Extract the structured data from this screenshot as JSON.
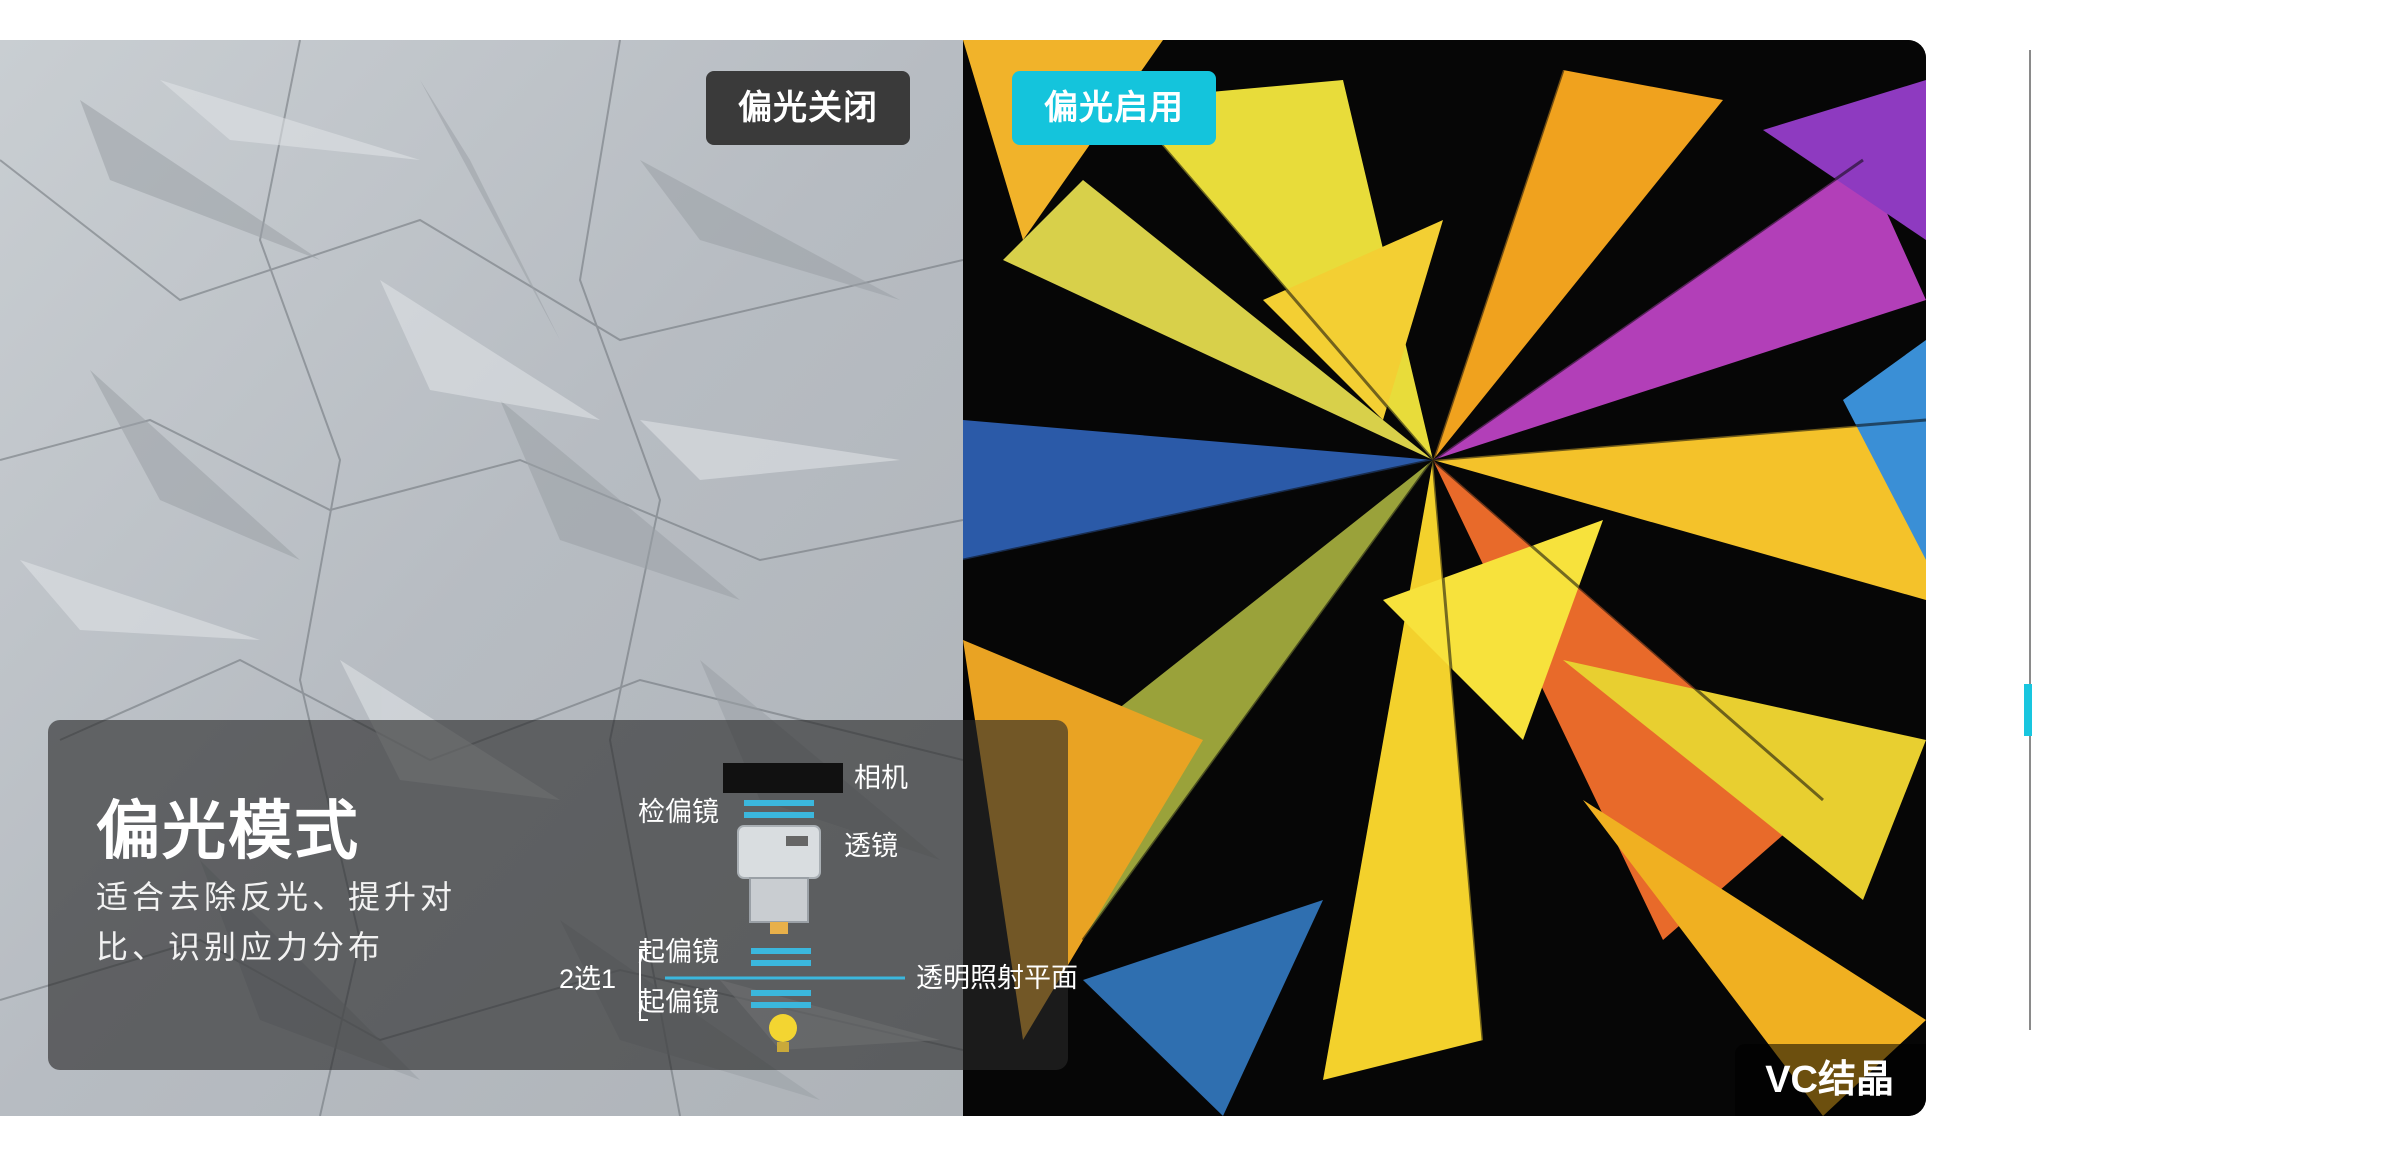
{
  "comparison": {
    "left_label": "偏光关闭",
    "right_label": "偏光启用",
    "accent_color": "#14c4dc",
    "image_caption": "VC结晶"
  },
  "info_card": {
    "title": "偏光模式",
    "description": "适合去除反光、提升对比、识别应力分布"
  },
  "diagram": {
    "camera": "相机",
    "analyzer": "检偏镜",
    "lens": "透镜",
    "polarizer_top": "起偏镜",
    "polarizer_bottom": "起偏镜",
    "choice": "2选1",
    "stage_plane": "透明照射平面"
  },
  "slider": {
    "position": 0.5
  },
  "icons": [
    "camera-icon",
    "lens-icon",
    "filter-icon",
    "light-bulb-icon"
  ]
}
